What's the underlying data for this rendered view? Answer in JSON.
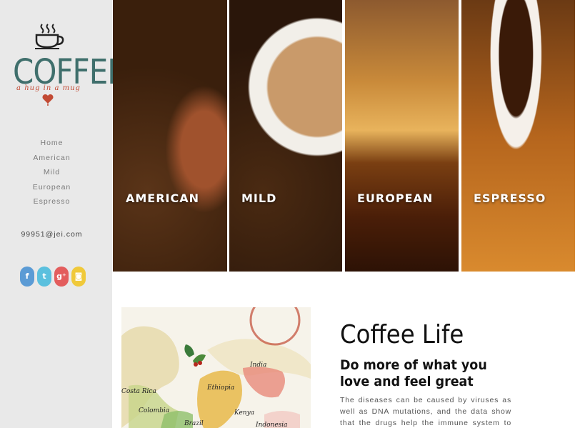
{
  "logo": {
    "word": "COFFEE",
    "tagline": "a hug in a mug",
    "brand_color": "#3f6f6c",
    "accent_color": "#c24a34"
  },
  "nav": [
    "Home",
    "American",
    "Mild",
    "European",
    "Espresso"
  ],
  "contact": {
    "email": "99951@jei.com"
  },
  "social": [
    {
      "icon": "facebook-icon",
      "glyph": "f",
      "color": "#5b9bd5"
    },
    {
      "icon": "twitter-icon",
      "glyph": "🐦",
      "color": "#5bc0de"
    },
    {
      "icon": "google-plus-icon",
      "glyph": "g⁺",
      "color": "#e35d5d"
    },
    {
      "icon": "instagram-icon",
      "glyph": "◙",
      "color": "#f0c93a"
    }
  ],
  "panels": [
    {
      "label": "AMERICAN"
    },
    {
      "label": "MILD"
    },
    {
      "label": "EUROPEAN"
    },
    {
      "label": "ESPRESSO"
    }
  ],
  "map": {
    "countries": [
      "India",
      "Ethiopia",
      "Kenya",
      "Costa Rica",
      "Colombia",
      "Brazil",
      "Indonesia"
    ]
  },
  "content": {
    "title": "Coffee Life",
    "subtitle": "Do more of what you love and feel great",
    "body": "The diseases can be caused by viruses as well as DNA mutations, and the data show that the drugs help the immune system to recognize and attack"
  }
}
